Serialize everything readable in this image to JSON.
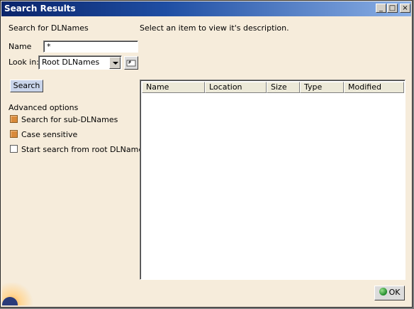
{
  "window": {
    "title": "Search Results",
    "controls": {
      "minimize": "_",
      "maximize": "□",
      "close": "×"
    }
  },
  "search_panel": {
    "heading": "Search for DLNames",
    "description": "Select an item to view it's description.",
    "name_label": "Name",
    "name_value": "*",
    "look_in_label": "Look in:",
    "look_in_value": "Root DLNames",
    "search_button": "Search"
  },
  "advanced": {
    "heading": "Advanced options",
    "options": [
      {
        "label": "Search for sub-DLNames",
        "checked": true
      },
      {
        "label": "Case sensitive",
        "checked": true
      },
      {
        "label": "Start search from root DLName",
        "checked": false
      }
    ]
  },
  "results": {
    "columns": [
      "Name",
      "Location",
      "Size",
      "Type",
      "Modified"
    ]
  },
  "footer": {
    "ok_label": "OK"
  },
  "colors": {
    "background": "#f6ecdb",
    "titlebar_start": "#0a246a",
    "checkbox_checked": "#d98a3a"
  }
}
